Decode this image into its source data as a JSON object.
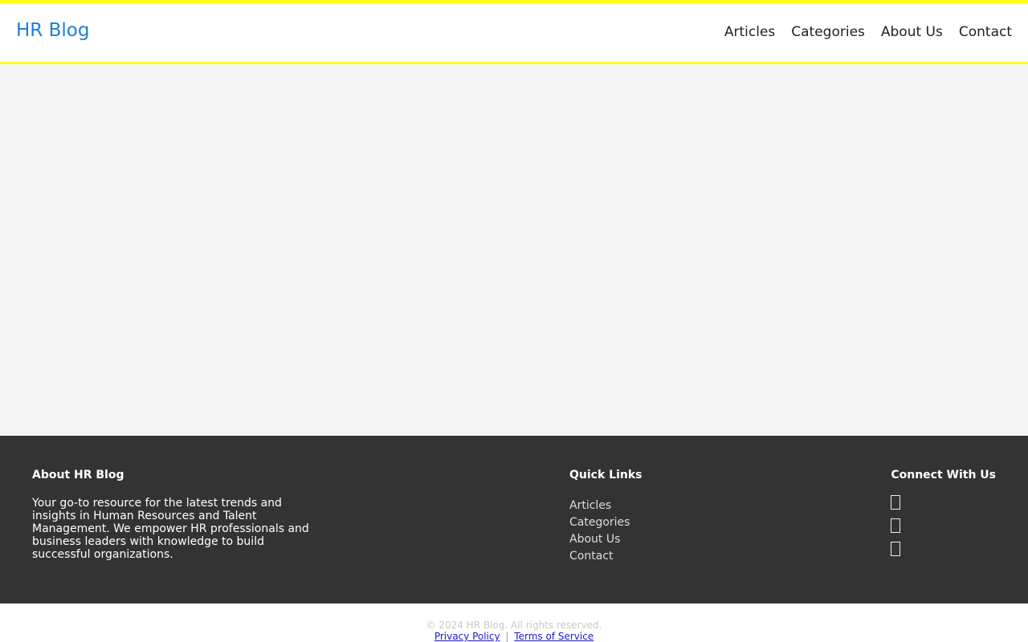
{
  "header": {
    "brand": "HR Blog",
    "nav": [
      "Articles",
      "Categories",
      "About Us",
      "Contact"
    ]
  },
  "footer": {
    "about": {
      "title": "About HR Blog",
      "text": "Your go-to resource for the latest trends and insights in Human Resources and Talent Management. We empower HR professionals and business leaders with knowledge to build successful organizations."
    },
    "quick_links": {
      "title": "Quick Links",
      "items": [
        "Articles",
        "Categories",
        "About Us",
        "Contact"
      ]
    },
    "social": {
      "title": "Connect With Us",
      "icons": [
        "social-icon-1",
        "social-icon-2",
        "social-icon-3"
      ]
    }
  },
  "bottom": {
    "copyright": "© 2024 HR Blog. All rights reserved.",
    "privacy": "Privacy Policy",
    "separator": "|",
    "terms": "Terms of Service"
  },
  "colors": {
    "accent_border": "#ffff1a",
    "brand": "#1a7fe0",
    "footer_bg": "#333333",
    "link": "#1a1ad0"
  }
}
